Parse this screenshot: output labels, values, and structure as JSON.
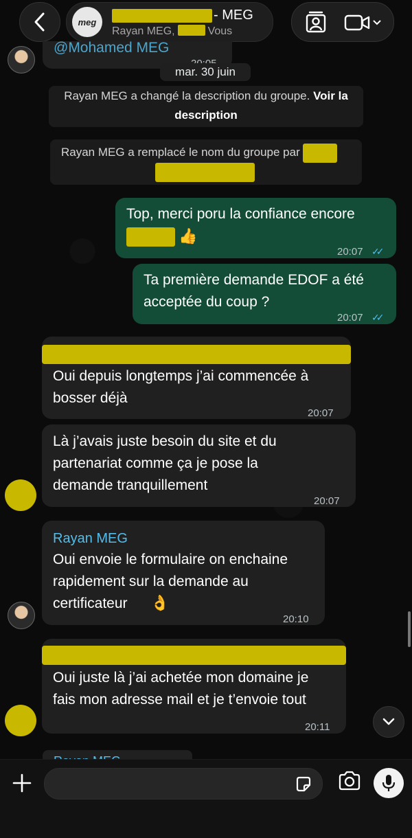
{
  "header": {
    "group_avatar_text": "meg",
    "title_suffix": "- MEG",
    "subtitle_prefix": "Rayan MEG,",
    "subtitle_suffix": "Vous"
  },
  "messages": {
    "top_preview_name": "@Mohamed MEG",
    "top_preview_time": "20:05",
    "date_chip": "mar. 30 juin",
    "system_1_text": "Rayan MEG a changé la description du groupe.",
    "system_1_link": "Voir la description",
    "system_2_text": "Rayan MEG a remplacé le nom du groupe par",
    "out_1_text": "Top, merci poru la confiance encore",
    "out_1_emoji": "👍",
    "out_1_time": "20:07",
    "out_2_line1": "Ta première demande EDOF a été",
    "out_2_line2": "acceptée du coup ?",
    "out_2_time": "20:07",
    "in_1_line1": "Oui depuis longtemps j’ai commencée à",
    "in_1_line2": "bosser déjà",
    "in_1_time": "20:07",
    "in_2_line1": "Là j’avais juste besoin du site et du",
    "in_2_line2": "partenariat comme ça je pose la",
    "in_2_line3": "demande tranquillement",
    "in_2_time": "20:07",
    "in_3_sender": "Rayan MEG",
    "in_3_line1": "Oui envoie le formulaire on enchaine",
    "in_3_line2": "rapidement sur la demande au",
    "in_3_line3": "certificateur",
    "in_3_emoji": "👌",
    "in_3_time": "20:10",
    "in_4_line1": "Oui juste là j’ai achetée mon domaine je",
    "in_4_line2": "fais mon adresse mail et je t’envoie tout",
    "in_4_time": "20:11",
    "cut_preview_sender": "Rayan MEG"
  },
  "input": {
    "placeholder": "",
    "value": ""
  },
  "colors": {
    "accent_blue": "#53bdeb",
    "outgoing_bubble": "#144d37",
    "incoming_bubble": "#202020",
    "redaction": "#c9b800"
  },
  "icons": [
    "back-icon",
    "person-card-icon",
    "video-icon",
    "chevron-down-icon",
    "plus-icon",
    "sticker-icon",
    "camera-icon",
    "mic-icon",
    "double-check-icon"
  ]
}
